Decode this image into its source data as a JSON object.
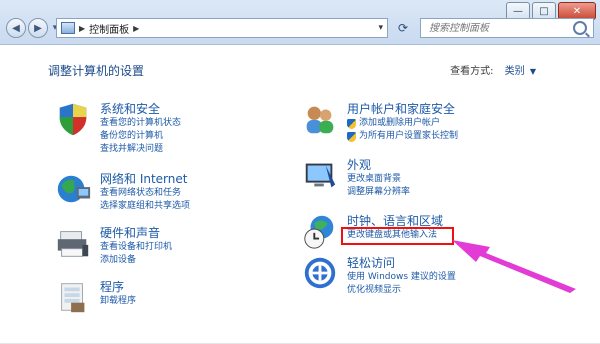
{
  "address": {
    "crumb": "控制面板"
  },
  "search": {
    "placeholder": "搜索控制面板"
  },
  "window_buttons": {
    "minimize": "—",
    "maximize": "□",
    "close": "✕"
  },
  "page": {
    "title": "调整计算机的设置",
    "view_by_label": "查看方式:",
    "view_by_value": "类别"
  },
  "categories": {
    "system": {
      "title": "系统和安全",
      "links": [
        "查看您的计算机状态",
        "备份您的计算机",
        "查找并解决问题"
      ]
    },
    "network": {
      "title": "网络和 Internet",
      "links": [
        "查看网络状态和任务",
        "选择家庭组和共享选项"
      ]
    },
    "hardware": {
      "title": "硬件和声音",
      "links": [
        "查看设备和打印机",
        "添加设备"
      ]
    },
    "programs": {
      "title": "程序",
      "links": [
        "卸载程序"
      ]
    },
    "users": {
      "title": "用户帐户和家庭安全",
      "links": [
        "添加或删除用户帐户",
        "为所有用户设置家长控制"
      ]
    },
    "appearance": {
      "title": "外观",
      "links": [
        "更改桌面背景",
        "调整屏幕分辨率"
      ]
    },
    "clock": {
      "title": "时钟、语言和区域",
      "links": [
        "更改键盘或其他输入法"
      ]
    },
    "ease": {
      "title": "轻松访问",
      "links": [
        "使用 Windows 建议的设置",
        "优化视频显示"
      ]
    }
  },
  "colors": {
    "accent": "#1d5aa7",
    "highlight": "#f01010",
    "arrow": "#e23bd6"
  }
}
